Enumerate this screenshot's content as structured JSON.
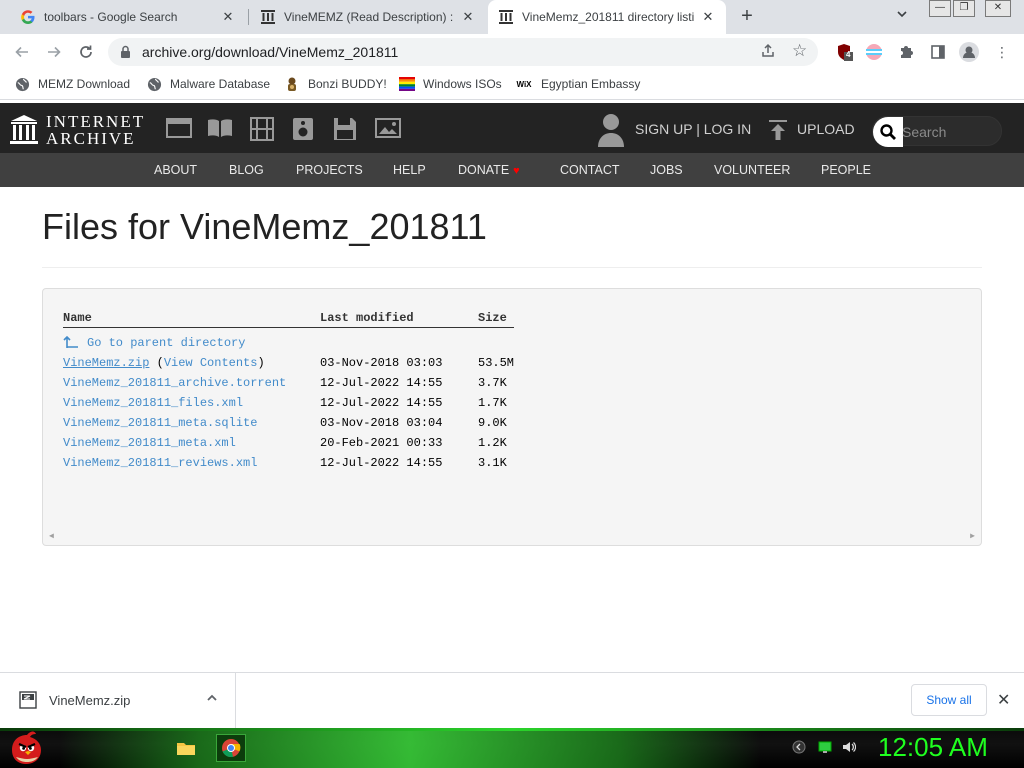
{
  "browser": {
    "tabs": [
      {
        "title": "toolbars - Google Search",
        "active": false
      },
      {
        "title": "VineMEMZ (Read Description) : F",
        "active": false
      },
      {
        "title": "VineMemz_201811 directory listi",
        "active": true
      }
    ],
    "new_tab_label": "+",
    "url": "archive.org/download/VineMemz_201811",
    "extension_badge": "4",
    "bookmarks": [
      {
        "label": "MEMZ Download",
        "icon": "globe-icon"
      },
      {
        "label": "Malware Database",
        "icon": "globe-icon"
      },
      {
        "label": "Bonzi BUDDY!",
        "icon": "bonzi-icon"
      },
      {
        "label": "Windows ISOs",
        "icon": "windows-flag-icon"
      },
      {
        "label": "Egyptian Embassy",
        "icon": "wix-icon"
      }
    ]
  },
  "ia": {
    "logo_line1": "INTERNET",
    "logo_line2": "ARCHIVE",
    "signup": "SIGN UP | LOG IN",
    "upload": "UPLOAD",
    "search_placeholder": "Search",
    "nav": [
      "ABOUT",
      "BLOG",
      "PROJECTS",
      "HELP",
      "DONATE",
      "CONTACT",
      "JOBS",
      "VOLUNTEER",
      "PEOPLE"
    ],
    "donate_heart": "♥"
  },
  "page": {
    "title": "Files for VineMemz_201811",
    "columns": {
      "name": "Name",
      "modified": "Last modified",
      "size": "Size"
    },
    "parent": "Go to parent directory",
    "files": [
      {
        "name": "VineMemz.zip",
        "extra_open": " (",
        "extra_link": "View Contents",
        "extra_close": ")",
        "modified": "03-Nov-2018 03:03",
        "size": "53.5M"
      },
      {
        "name": "VineMemz_201811_archive.torrent",
        "modified": "12-Jul-2022 14:55",
        "size": "3.7K"
      },
      {
        "name": "VineMemz_201811_files.xml",
        "modified": "12-Jul-2022 14:55",
        "size": "1.7K"
      },
      {
        "name": "VineMemz_201811_meta.sqlite",
        "modified": "03-Nov-2018 03:04",
        "size": "9.0K"
      },
      {
        "name": "VineMemz_201811_meta.xml",
        "modified": "20-Feb-2021 00:33",
        "size": "1.2K"
      },
      {
        "name": "VineMemz_201811_reviews.xml",
        "modified": "12-Jul-2022 14:55",
        "size": "3.1K"
      }
    ]
  },
  "downloads": {
    "file": "VineMemz.zip",
    "show_all": "Show all"
  },
  "taskbar": {
    "clock": "12:05 AM"
  },
  "colors": {
    "ia_dark": "#232323",
    "ia_nav": "#404040",
    "link": "#428bca",
    "clock_green": "#1fff1f"
  }
}
